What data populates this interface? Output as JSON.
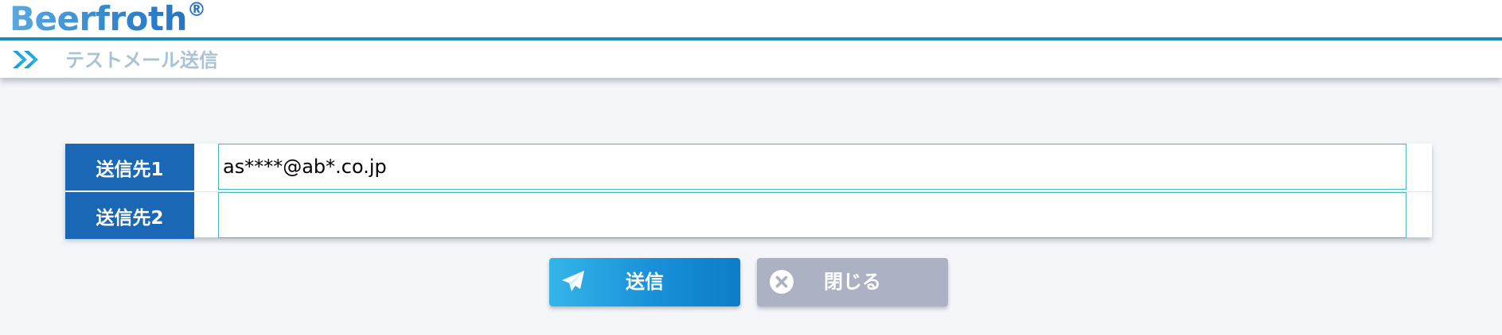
{
  "header": {
    "logo_text": "Beerfroth",
    "logo_reg": "®"
  },
  "subbar": {
    "icon": "double-chevron-right-icon",
    "title": "テストメール送信"
  },
  "form": {
    "rows": [
      {
        "label": "送信先1",
        "value": "as****@ab*.co.jp"
      },
      {
        "label": "送信先2",
        "value": ""
      }
    ]
  },
  "actions": {
    "send_label": "送信",
    "send_icon": "paper-plane-icon",
    "close_label": "閉じる",
    "close_icon": "close-circle-icon"
  },
  "colors": {
    "accent": "#1a8ab8",
    "label_bg": "#1a67b5",
    "send_button": "#1990d8",
    "close_button": "#acb1c3",
    "background": "#f4f6fa"
  }
}
